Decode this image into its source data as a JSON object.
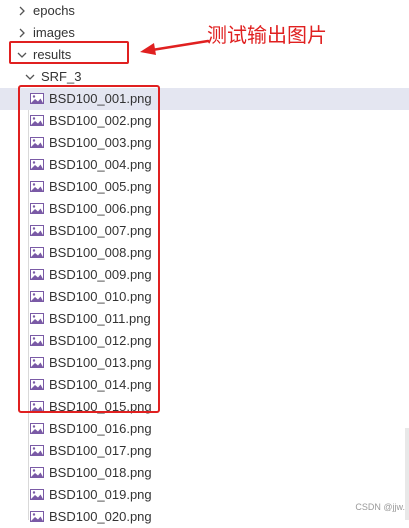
{
  "explorer": {
    "folders": [
      {
        "label": "epochs",
        "expanded": false
      },
      {
        "label": "images",
        "expanded": false
      },
      {
        "label": "results",
        "expanded": true
      },
      {
        "label": "SRF_3",
        "expanded": true
      }
    ],
    "files": [
      "BSD100_001.png",
      "BSD100_002.png",
      "BSD100_003.png",
      "BSD100_004.png",
      "BSD100_005.png",
      "BSD100_006.png",
      "BSD100_007.png",
      "BSD100_008.png",
      "BSD100_009.png",
      "BSD100_010.png",
      "BSD100_011.png",
      "BSD100_012.png",
      "BSD100_013.png",
      "BSD100_014.png",
      "BSD100_015.png",
      "BSD100_016.png",
      "BSD100_017.png",
      "BSD100_018.png",
      "BSD100_019.png",
      "BSD100_020.png"
    ],
    "selected_file": "BSD100_001.png",
    "file_icon": "image-file-icon",
    "folder_icon_collapsed": "chevron-right-icon",
    "folder_icon_expanded": "chevron-down-icon"
  },
  "annotation": {
    "text": "测试输出图片",
    "color": "#e02020"
  },
  "watermark": {
    "text": "CSDN @jjw."
  },
  "colors": {
    "selection_bg": "#e4e6f1",
    "highlight_box": "#e02020",
    "text": "#333333"
  }
}
